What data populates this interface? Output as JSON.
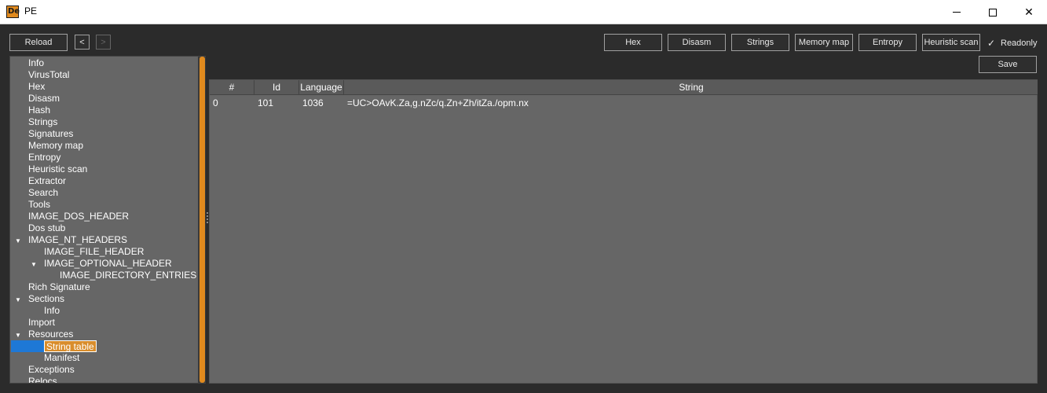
{
  "window": {
    "title": "PE",
    "icon_label": "De",
    "controls": {
      "minimize": "minimize-icon",
      "maximize": "maximize-icon",
      "close": "close-icon",
      "close_glyph": "✕"
    }
  },
  "toolbar": {
    "reload_label": "Reload",
    "back_label": "<",
    "forward_label": ">",
    "hex_label": "Hex",
    "disasm_label": "Disasm",
    "strings_label": "Strings",
    "memory_map_label": "Memory map",
    "entropy_label": "Entropy",
    "heuristic_scan_label": "Heuristic scan",
    "readonly_label": "Readonly",
    "readonly_checked": true,
    "check_glyph": "✓",
    "save_label": "Save"
  },
  "tree": {
    "items": [
      {
        "label": "Info",
        "level": 1
      },
      {
        "label": "VirusTotal",
        "level": 1
      },
      {
        "label": "Hex",
        "level": 1
      },
      {
        "label": "Disasm",
        "level": 1
      },
      {
        "label": "Hash",
        "level": 1
      },
      {
        "label": "Strings",
        "level": 1
      },
      {
        "label": "Signatures",
        "level": 1
      },
      {
        "label": "Memory map",
        "level": 1
      },
      {
        "label": "Entropy",
        "level": 1
      },
      {
        "label": "Heuristic scan",
        "level": 1
      },
      {
        "label": "Extractor",
        "level": 1
      },
      {
        "label": "Search",
        "level": 1
      },
      {
        "label": "Tools",
        "level": 1
      },
      {
        "label": "IMAGE_DOS_HEADER",
        "level": 1
      },
      {
        "label": "Dos stub",
        "level": 1
      },
      {
        "label": "IMAGE_NT_HEADERS",
        "level": 1,
        "expanded": true
      },
      {
        "label": "IMAGE_FILE_HEADER",
        "level": 2
      },
      {
        "label": "IMAGE_OPTIONAL_HEADER",
        "level": 2,
        "expanded": true
      },
      {
        "label": "IMAGE_DIRECTORY_ENTRIES",
        "level": 3
      },
      {
        "label": "Rich Signature",
        "level": 1
      },
      {
        "label": "Sections",
        "level": 1,
        "expanded": true
      },
      {
        "label": "Info",
        "level": 2
      },
      {
        "label": "Import",
        "level": 1
      },
      {
        "label": "Resources",
        "level": 1,
        "expanded": true
      },
      {
        "label": "String table",
        "level": 2,
        "selected": true
      },
      {
        "label": "Manifest",
        "level": 2
      },
      {
        "label": "Exceptions",
        "level": 1
      },
      {
        "label": "Relocs",
        "level": 1
      }
    ]
  },
  "table": {
    "columns": [
      "#",
      "Id",
      "Language",
      "String"
    ],
    "rows": [
      [
        "0",
        "101",
        "1036",
        "=UC>OAvK.Za,g.nZc/q.Zn+Zh/itZa./opm.nx"
      ]
    ]
  },
  "colors": {
    "accent": "#e08a1e",
    "selection": "#1e78d6",
    "panel": "#666666",
    "background": "#2b2b2b"
  }
}
